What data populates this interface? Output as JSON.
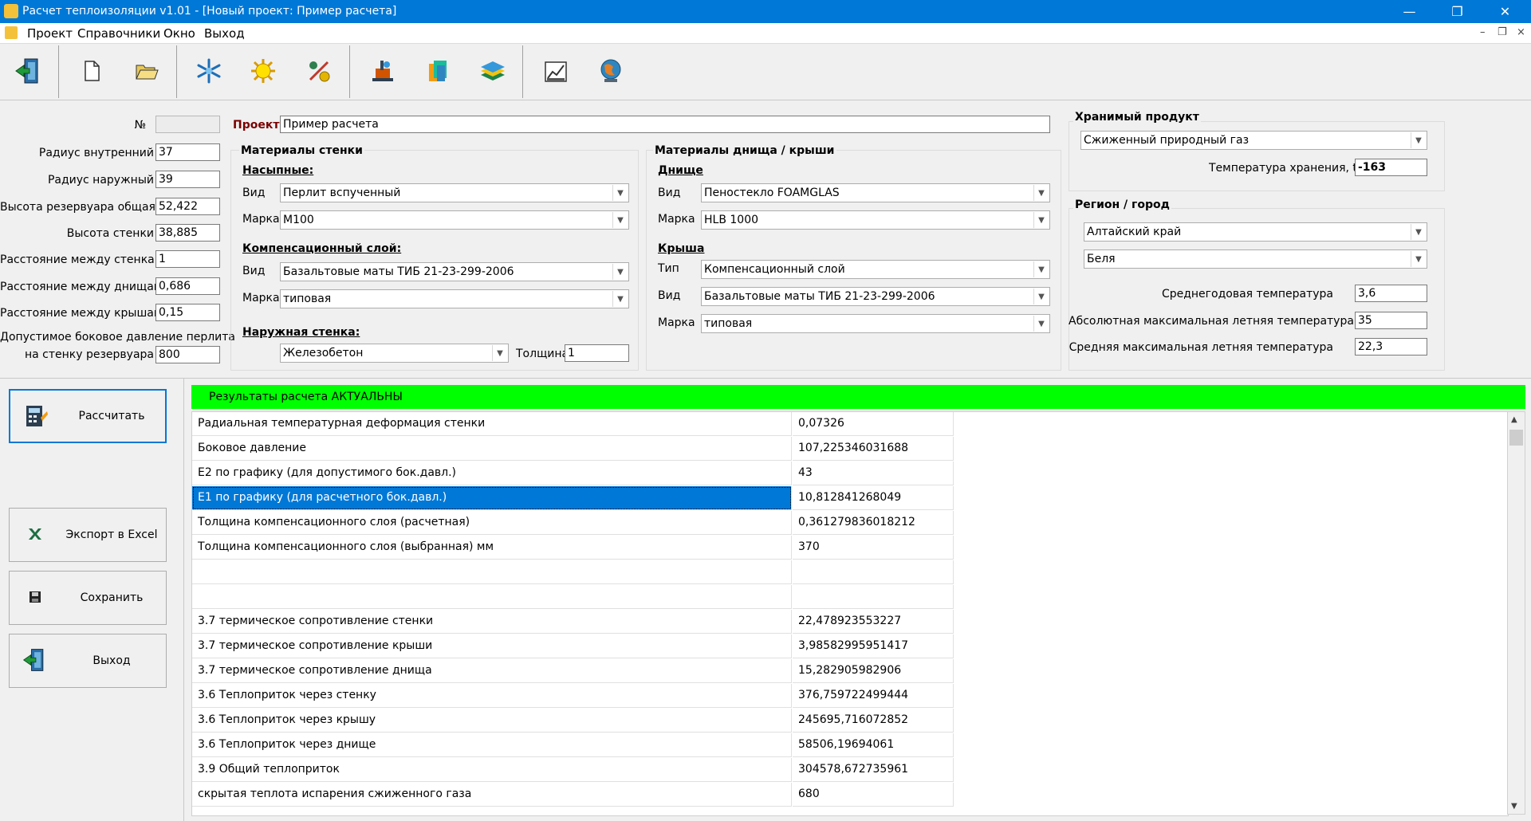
{
  "window": {
    "title": "Расчет теплоизоляции v1.01 - [Новый проект: Пример расчета]",
    "minimize": "—",
    "maximize": "❐",
    "close": "✕"
  },
  "menu": {
    "items": [
      "Проект",
      "Справочники",
      "Окно",
      "Выход"
    ],
    "mdi_min": "–",
    "mdi_restore": "❐",
    "mdi_close": "×"
  },
  "toolbar": {
    "icons": [
      "exit-icon",
      "new-file-icon",
      "open-folder-icon",
      "snowflake-icon",
      "sun-icon",
      "percent-settings-icon",
      "building-icon",
      "layers-book-icon",
      "layers-stack-icon",
      "chart-report-icon",
      "globe-icon"
    ]
  },
  "params": {
    "no_label": "№",
    "no_value": "",
    "r_in_label": "Радиус внутренний",
    "r_in": "37",
    "r_out_label": "Радиус наружный",
    "r_out": "39",
    "h_total_label": "Высота резервуара общая",
    "h_total": "52,422",
    "h_wall_label": "Высота стенки",
    "h_wall": "38,885",
    "d_walls_label": "Расстояние между стенками",
    "d_walls": "1",
    "d_bottoms_label": "Расстояние между днищами",
    "d_bottoms": "0,686",
    "d_roofs_label": "Расстояние между крышами",
    "d_roofs": "0,15",
    "pressure_label1": "Допустимое боковое давление  перлита",
    "pressure_label2": "на стенку резервуара",
    "pressure": "800"
  },
  "project": {
    "label": "Проект",
    "value": "Пример расчета"
  },
  "wall": {
    "header": "Материалы стенки",
    "bulk_title": "Насыпные:",
    "bulk_kind_label": "Вид",
    "bulk_kind": "Перлит вспученный",
    "bulk_mark_label": "Марка",
    "bulk_mark": "M100",
    "comp_title": "Компенсационный слой:",
    "comp_kind_label": "Вид",
    "comp_kind": "Базальтовые маты ТИБ 21-23-299-2006",
    "comp_mark_label": "Марка",
    "comp_mark": "типовая",
    "outer_title": "Наружная стенка:",
    "outer_kind": "Железобетон",
    "thickness_label": "Толщина",
    "thickness": "1"
  },
  "bottom": {
    "header": "Материалы днища / крыши",
    "bottom_title": "Днище",
    "b_kind_label": "Вид",
    "b_kind": "Пеностекло FOAMGLAS",
    "b_mark_label": "Марка",
    "b_mark": "HLB 1000",
    "roof_title": "Крыша",
    "r_type_label": "Тип",
    "r_type": "Компенсационный слой",
    "r_kind_label": "Вид",
    "r_kind": "Базальтовые маты ТИБ 21-23-299-2006",
    "r_mark_label": "Марка",
    "r_mark": "типовая"
  },
  "product": {
    "header": "Хранимый продукт",
    "value": "Сжиженный природный газ",
    "temp_label": "Температура хранения, t, C",
    "temp": "-163"
  },
  "region": {
    "header": "Регион / город",
    "region": "Алтайский край",
    "city": "Беля",
    "avg_label": "Среднегодовая температура",
    "avg": "3,6",
    "absmax_label": "Абсолютная максимальная летняя температура",
    "absmax": "35",
    "avgmax_label": "Средняя максимальная летняя температура",
    "avgmax": "22,3"
  },
  "buttons": {
    "calc": "Рассчитать",
    "excel": "Экспорт в Excel",
    "save": "Сохранить",
    "exit": "Выход"
  },
  "results": {
    "status": "Результаты расчета АКТУАЛЬНЫ",
    "rows": [
      {
        "name": "Радиальная температурная деформация стенки",
        "value": "0,07326"
      },
      {
        "name": "Боковое давление",
        "value": "107,225346031688"
      },
      {
        "name": "E2 по графику (для допустимого бок.давл.)",
        "value": "43"
      },
      {
        "name": "E1 по графику (для расчетного бок.давл.)",
        "value": "10,812841268049"
      },
      {
        "name": "Толщина компенсационного слоя (расчетная)",
        "value": "0,361279836018212"
      },
      {
        "name": "Толщина компенсационного слоя (выбранная) мм",
        "value": "370"
      },
      {
        "name": "",
        "value": ""
      },
      {
        "name": "",
        "value": ""
      },
      {
        "name": "3.7 термическое сопротивление стенки",
        "value": "22,478923553227"
      },
      {
        "name": "3.7 термическое сопротивление крыши",
        "value": "3,98582995951417"
      },
      {
        "name": "3.7 термическое сопротивление днища",
        "value": "15,282905982906"
      },
      {
        "name": "3.6 Теплоприток через стенку",
        "value": "376,759722499444"
      },
      {
        "name": "3.6 Теплоприток через крышу",
        "value": "245695,716072852"
      },
      {
        "name": "3.6 Теплоприток через днище",
        "value": "58506,19694061"
      },
      {
        "name": "3.9 Общий теплоприток",
        "value": "304578,672735961"
      },
      {
        "name": "скрытая теплота испарения сжиженного газа",
        "value": "680"
      }
    ],
    "selected_row": 3
  },
  "colors": {
    "titlebar": "#0078d7",
    "status_ok": "#00ff00",
    "selection": "#0078d7",
    "label_dark_red": "#7a0000"
  }
}
